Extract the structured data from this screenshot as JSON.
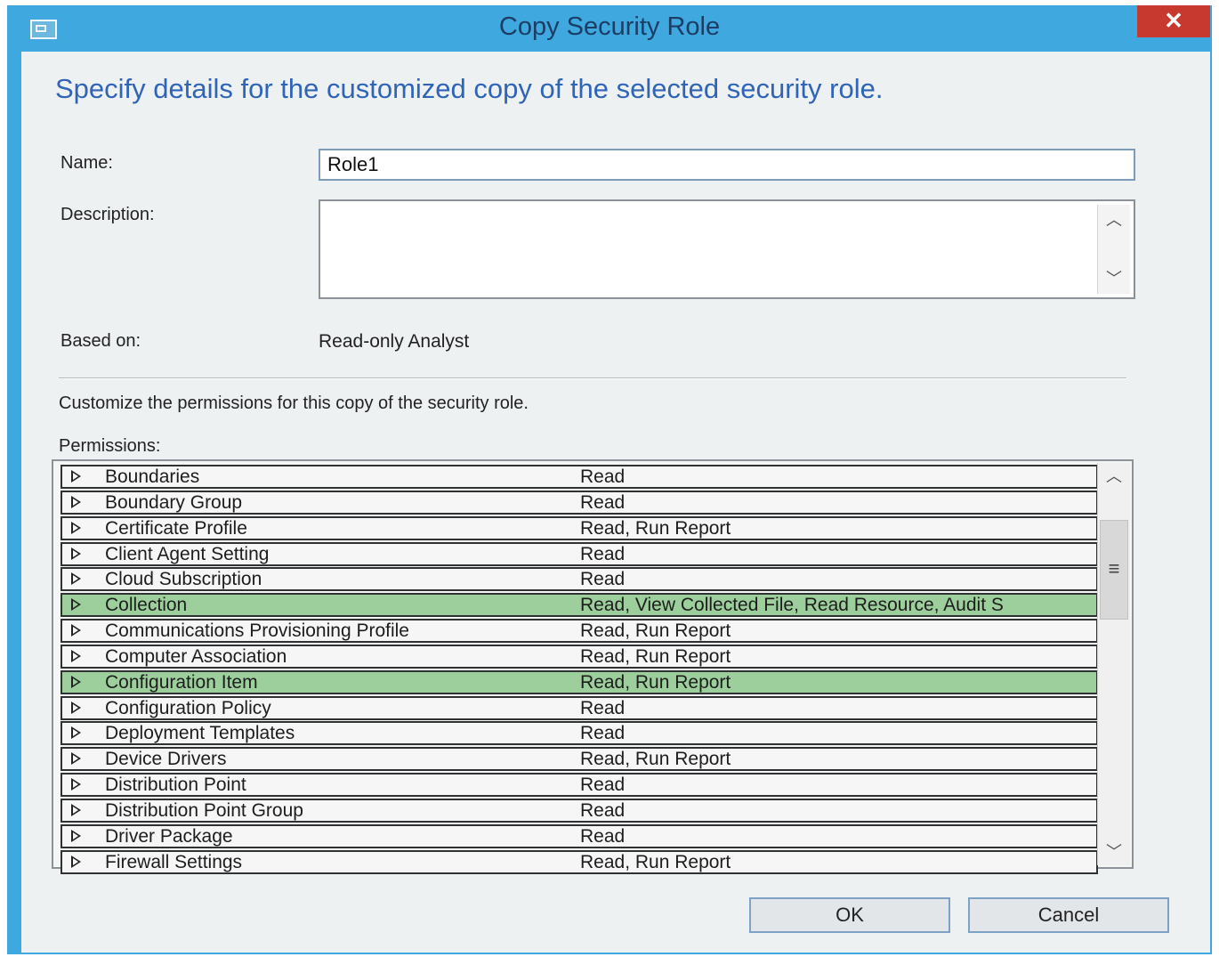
{
  "window": {
    "title": "Copy Security Role",
    "close_label": "✕"
  },
  "heading": "Specify details for the customized copy of the selected security role.",
  "form": {
    "name_label": "Name:",
    "name_value": "Role1",
    "description_label": "Description:",
    "description_value": "",
    "based_on_label": "Based on:",
    "based_on_value": "Read-only Analyst"
  },
  "customize_text": "Customize the permissions for this copy of the security role.",
  "permissions": {
    "label": "Permissions:",
    "rows": [
      {
        "name": "Boundaries",
        "perm": "Read",
        "selected": false
      },
      {
        "name": "Boundary Group",
        "perm": "Read",
        "selected": false
      },
      {
        "name": "Certificate Profile",
        "perm": "Read, Run Report",
        "selected": false
      },
      {
        "name": "Client Agent Setting",
        "perm": "Read",
        "selected": false
      },
      {
        "name": "Cloud Subscription",
        "perm": "Read",
        "selected": false
      },
      {
        "name": "Collection",
        "perm": "Read, View Collected File, Read Resource, Audit S",
        "selected": true
      },
      {
        "name": "Communications Provisioning Profile",
        "perm": "Read, Run Report",
        "selected": false
      },
      {
        "name": "Computer Association",
        "perm": "Read, Run Report",
        "selected": false
      },
      {
        "name": "Configuration Item",
        "perm": "Read, Run Report",
        "selected": true
      },
      {
        "name": "Configuration Policy",
        "perm": "Read",
        "selected": false
      },
      {
        "name": "Deployment Templates",
        "perm": "Read",
        "selected": false
      },
      {
        "name": "Device Drivers",
        "perm": "Read, Run Report",
        "selected": false
      },
      {
        "name": "Distribution Point",
        "perm": "Read",
        "selected": false
      },
      {
        "name": "Distribution Point Group",
        "perm": "Read",
        "selected": false
      },
      {
        "name": "Driver Package",
        "perm": "Read",
        "selected": false
      },
      {
        "name": "Firewall Settings",
        "perm": "Read, Run Report",
        "selected": false
      }
    ]
  },
  "buttons": {
    "ok": "OK",
    "cancel": "Cancel"
  }
}
